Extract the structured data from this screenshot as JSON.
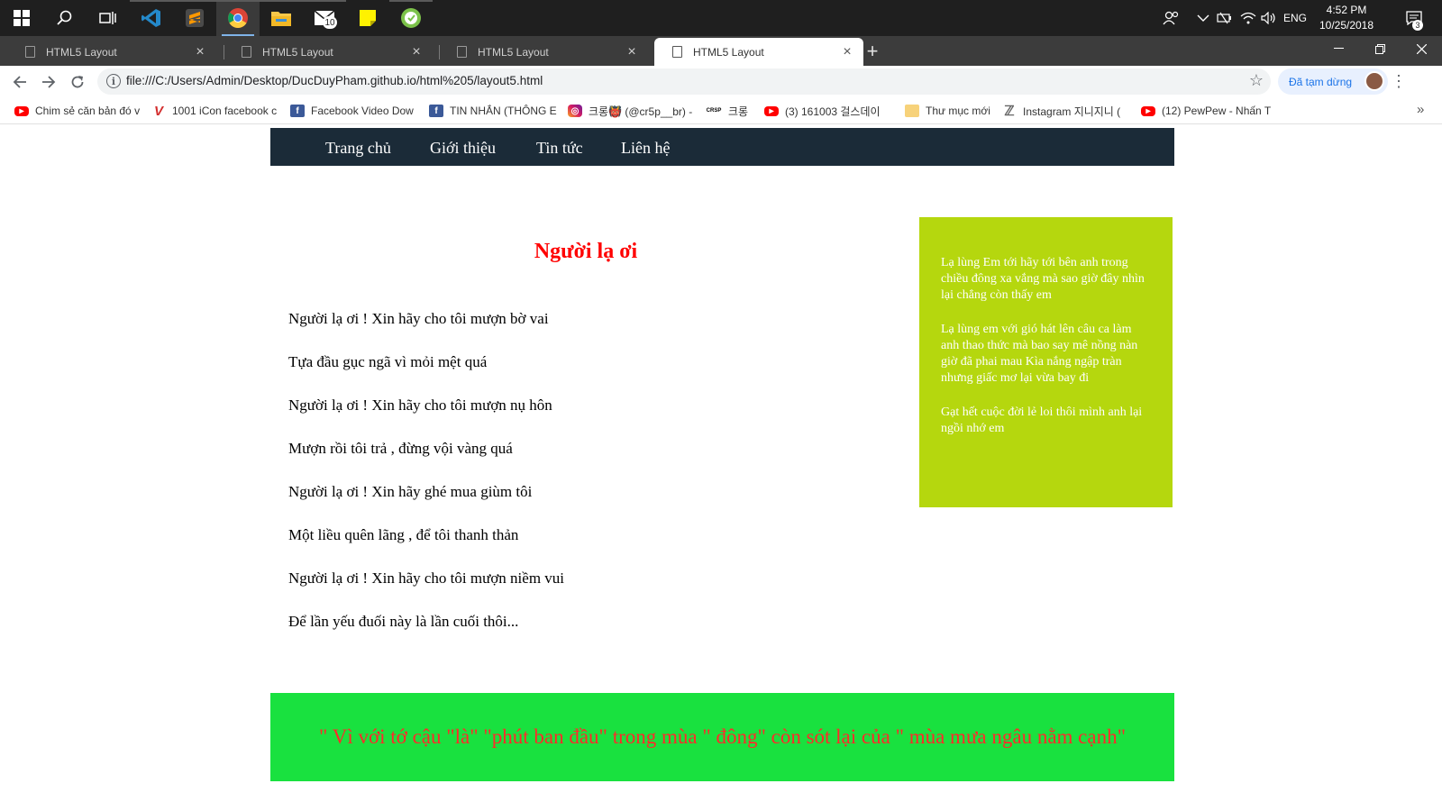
{
  "taskbar": {
    "icons": [
      "windows-start-icon",
      "search-icon",
      "task-view-icon",
      "vscode-icon",
      "sublime-icon",
      "chrome-icon",
      "file-explorer-icon",
      "mail-icon",
      "sticky-notes-icon",
      "app-icon"
    ],
    "mail_badge": "10",
    "tray_language": "ENG",
    "clock_time": "4:52 PM",
    "clock_date": "10/25/2018",
    "notification_count": "3"
  },
  "tabs": [
    {
      "title": "HTML5 Layout",
      "active": false
    },
    {
      "title": "HTML5 Layout",
      "active": false
    },
    {
      "title": "HTML5 Layout",
      "active": false
    },
    {
      "title": "HTML5 Layout",
      "active": true
    }
  ],
  "address_bar": {
    "url": "file:///C:/Users/Admin/Desktop/DucDuyPham.github.io/html%205/layout5.html",
    "profile_label": "Đã tạm dừng"
  },
  "bookmarks": [
    {
      "label": "Chim sẻ căn bản đó v",
      "icon": "youtube-icon"
    },
    {
      "label": "1001 iCon facebook c",
      "icon": "v-icon"
    },
    {
      "label": "Facebook Video Dow",
      "icon": "facebook-icon"
    },
    {
      "label": "TIN NHẮN (THÔNG E",
      "icon": "facebook-icon"
    },
    {
      "label": "크롱👹 (@cr5p__br) -",
      "icon": "instagram-icon"
    },
    {
      "label": "크롱",
      "icon": "crsp-icon"
    },
    {
      "label": "(3) 161003 걸스데이",
      "icon": "youtube-icon"
    },
    {
      "label": "Thư mục mới",
      "icon": "folder-icon"
    },
    {
      "label": "Instagram 지니지니 (",
      "icon": "z-icon"
    },
    {
      "label": "(12) PewPew - Nhấn T",
      "icon": "youtube-icon"
    }
  ],
  "page": {
    "nav": [
      "Trang chủ",
      "Giới thiệu",
      "Tin tức",
      "Liên hệ"
    ],
    "article": {
      "title": "Người lạ ơi",
      "lines": [
        "Người lạ ơi ! Xin hãy cho tôi mượn bờ vai",
        "Tựa đầu gục ngã vì mỏi mệt quá",
        "Người lạ ơi ! Xin hãy cho tôi mượn nụ hôn",
        "Mượn rồi tôi trả , đừng vội vàng quá",
        "Người lạ ơi ! Xin hãy ghé mua giùm tôi",
        "Một liều quên lãng , để tôi thanh thản",
        "Người lạ ơi ! Xin hãy cho tôi mượn niềm vui",
        "Để lần yếu đuối này là lần cuối thôi..."
      ]
    },
    "aside": [
      "Lạ lùng Em tới hãy tới bên anh trong chiều đông xa vắng mà sao giờ đây nhìn lại chẳng còn thấy em",
      "Lạ lùng em với gió hát lên câu ca làm anh thao thức mà bao say mê nồng nàn giờ đã phai mau Kìa nắng ngập tràn nhưng giấc mơ lại vừa bay đi",
      "Gạt hết cuộc đời lẻ loi thôi mình anh lại ngồi nhớ em"
    ],
    "footer": "\" Vì với tớ cậu \"là\" \"phút ban đầu\" trong mùa \" đông\" còn sót lại của \" mùa mưa ngâu nằm cạnh\"",
    "colors": {
      "nav_bg": "#1b2b38",
      "title": "#ff0000",
      "aside_bg": "#b5d70e",
      "footer_bg": "#19e13f",
      "footer_text": "#ff2a2a"
    }
  }
}
